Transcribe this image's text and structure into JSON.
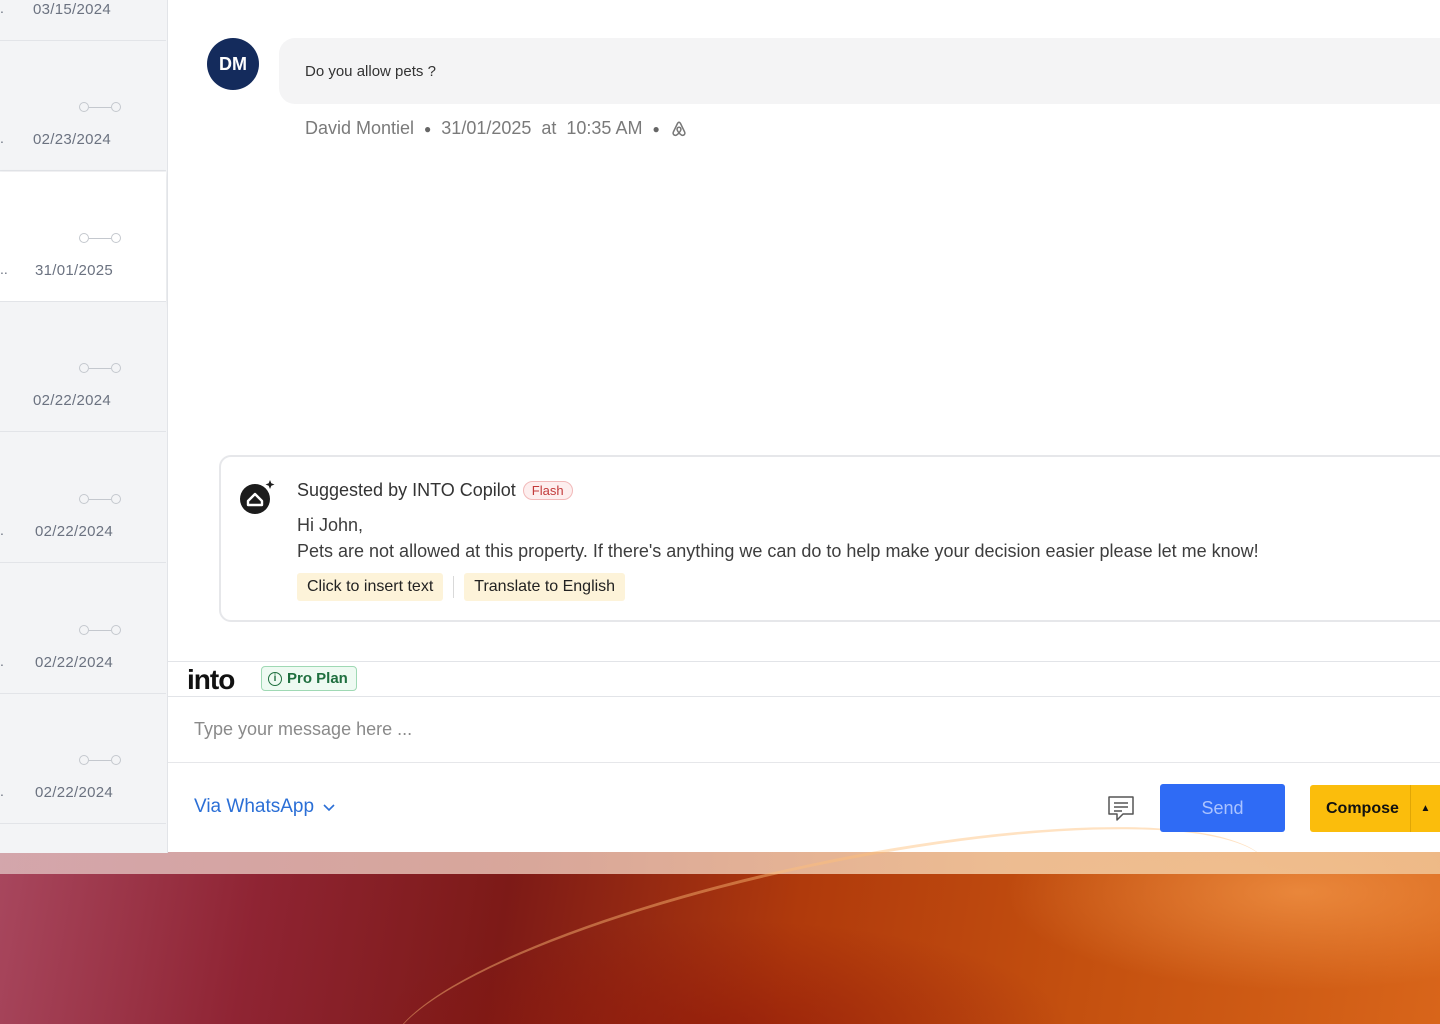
{
  "conversations": [
    {
      "date": "03/15/2024",
      "prefix": "."
    },
    {
      "date": "02/23/2024",
      "prefix": "."
    },
    {
      "date": "31/01/2025",
      "prefix": ".."
    },
    {
      "date": "02/22/2024",
      "prefix": ""
    },
    {
      "date": "02/22/2024",
      "prefix": "."
    },
    {
      "date": "02/22/2024",
      "prefix": "."
    },
    {
      "date": "02/22/2024",
      "prefix": "."
    }
  ],
  "message": {
    "avatar_initials": "DM",
    "text": "Do you allow pets ?",
    "sender": "David Montiel",
    "timestamp": "31/01/2025  at  10:35 AM",
    "channel_icon": "airbnb-icon"
  },
  "copilot": {
    "title": "Suggested by INTO Copilot",
    "badge": "Flash",
    "greeting": "Hi John,",
    "body": "Pets are not allowed at this property. If there's anything we can do to help make your decision easier please let me know!",
    "insert_label": "Click to insert text",
    "translate_label": "Translate to English"
  },
  "brand": {
    "logo_text": "into",
    "plan_label": "Pro Plan"
  },
  "composer": {
    "placeholder": "Type your message here ...",
    "channel_label": "Via WhatsApp",
    "send_label": "Send",
    "compose_label": "Compose"
  },
  "colors": {
    "avatar": "#142b5c",
    "send": "#2f6bf5",
    "compose": "#fbbd0c",
    "link": "#2b6fd6"
  }
}
